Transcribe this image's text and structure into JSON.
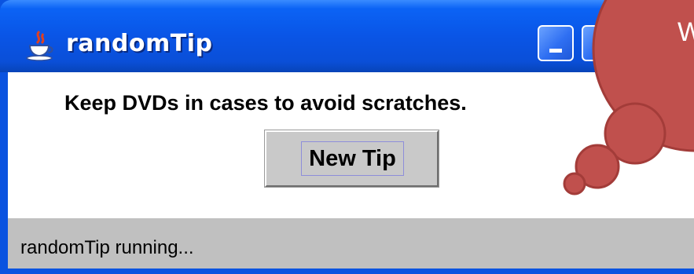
{
  "window": {
    "title": "randomTip",
    "app_icon": "java-coffee-cup-icon",
    "minimize_icon": "minimize-icon",
    "maximize_icon": "maximize-icon"
  },
  "content": {
    "tip_text": "Keep DVDs in cases to avoid scratches.",
    "new_tip_label": "New Tip"
  },
  "status": {
    "text": "randomTip running..."
  },
  "overlay": {
    "bubble_text": "W",
    "bubble_color": "#c0504d"
  },
  "colors": {
    "titlebar": "#0a55e6",
    "statusbar": "#c0c0c0",
    "button": "#c9c9c9"
  }
}
